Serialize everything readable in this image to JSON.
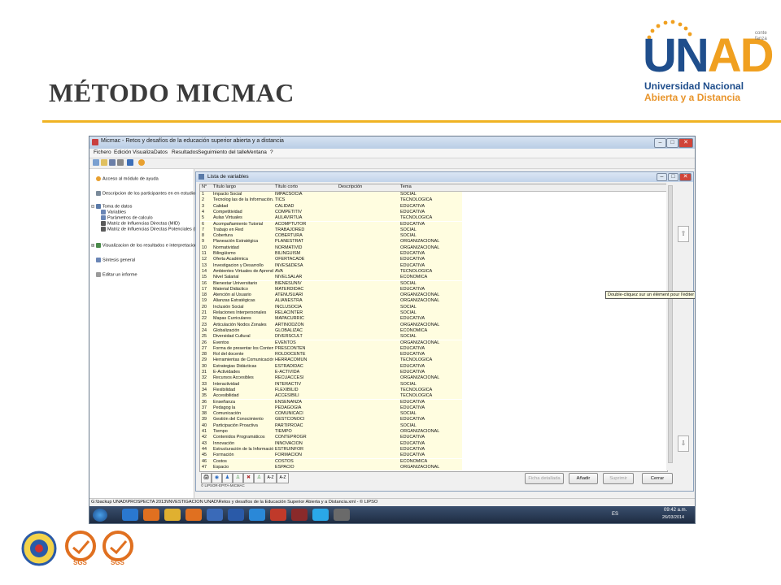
{
  "slide": {
    "title": "MÉTODO MICMAC"
  },
  "logo": {
    "letters_u": "U",
    "letters_n": "N",
    "letters_ad": "AD",
    "line1": "Universidad Nacional",
    "line2": "Abierta y a Distancia",
    "corner_text": "conte\nfanza"
  },
  "window": {
    "title": "Micmac  - Retos y desafíos de la educación superior abierta y a distancia",
    "menu": [
      "Fichero",
      "Edición",
      "Visualiza",
      "Datos",
      "Resultados",
      "Seguimiento del taller",
      "Ventana",
      "?"
    ]
  },
  "tree": {
    "items": [
      {
        "label": "Acceso al módulo de ayuda",
        "icon": "help-icon"
      },
      {
        "label": "Descripcion de los participantes en en estudio",
        "icon": "people-icon"
      },
      {
        "label": "Toma de datos",
        "icon": "data-icon"
      },
      {
        "label": "Variables",
        "icon": "variables-icon"
      },
      {
        "label": "Parámetros de calculo",
        "icon": "params-icon"
      },
      {
        "label": "Matriz de Influencias Directas (MID)",
        "icon": "matrix-icon"
      },
      {
        "label": "Matriz de Influencias Directas Potenciales (M",
        "icon": "matrix-icon"
      },
      {
        "label": "Visualizacion de los resultados e interpretaciones",
        "icon": "chart-icon"
      },
      {
        "label": "Síntesis general",
        "icon": "summary-icon"
      },
      {
        "label": "Editar un informe",
        "icon": "edit-icon"
      }
    ]
  },
  "list": {
    "title": "Lista de variables",
    "columns": [
      "N°",
      "Título largo",
      "Título corto",
      "Descripción",
      "Tema"
    ],
    "rows": [
      [
        "1",
        "Impacto Social",
        "IMPACSOCIA",
        "",
        "SOCIAL"
      ],
      [
        "2",
        "Tecnolog las de la Información...",
        "TICS",
        "",
        "TECNOLÓGICA"
      ],
      [
        "3",
        "Calidad",
        "CALIDAD",
        "",
        "EDUCATIVA"
      ],
      [
        "4",
        "Competitividad",
        "COMPETITIV",
        "",
        "EDUCATIVA"
      ],
      [
        "5",
        "Aulas Virtuales",
        "AULAVIRTUA",
        "",
        "TECNOLÓGICA"
      ],
      [
        "6",
        "Acompañamiento Tutorial",
        "ACOMPTUTOR",
        "",
        "EDUCATIVA"
      ],
      [
        "7",
        "Trabajo en Red",
        "TRABAJORED",
        "",
        "SOCIAL"
      ],
      [
        "8",
        "Cobertura",
        "COBERTURA",
        "",
        "SOCIAL"
      ],
      [
        "9",
        "Planeación Estratégica",
        "PLANESTRAT",
        "",
        "ORGANIZACIONAL"
      ],
      [
        "10",
        "Normatividad",
        "NORMATIVID",
        "",
        "ORGANIZACIONAL"
      ],
      [
        "11",
        "Bilingüismo",
        "BILINGÜISM",
        "",
        "EDUCATIVA"
      ],
      [
        "12",
        "Oferta Académica",
        "OFERTACADE",
        "",
        "EDUCATIVA"
      ],
      [
        "13",
        "Investigacion y Desarrollo",
        "INVES&DESA",
        "",
        "EDUCATIVA"
      ],
      [
        "14",
        "Ambientes Virtuales de Aprend...",
        "AVA",
        "",
        "TECNOLÓGICA"
      ],
      [
        "15",
        "Nivel Salarial",
        "NIVELSALAR",
        "",
        "ECONÓMICA"
      ],
      [
        "16",
        "Bienestar Universitario",
        "BIENESUNIV",
        "",
        "SOCIAL"
      ],
      [
        "17",
        "Material Didáctico",
        "MATERDIDAC",
        "",
        "EDUCATIVA"
      ],
      [
        "18",
        "Atención al Usuario",
        "ATENUSUARI",
        "",
        "ORGANIZACIONAL"
      ],
      [
        "19",
        "Alianzas Estratégicas",
        "ALIANESTRA",
        "",
        "ORGANIZACIONAL"
      ],
      [
        "20",
        "Inclusión Social",
        "INCLUSOCIA",
        "",
        "SOCIAL"
      ],
      [
        "21",
        "Relaciones Interpersonales",
        "RELACINTER",
        "",
        "SOCIAL"
      ],
      [
        "22",
        "Mapas Curriculares",
        "MAPACURRIC",
        "",
        "EDUCATIVA"
      ],
      [
        "23",
        "Articulación Nodos Zonales",
        "ARTINODZON",
        "",
        "ORGANIZACIONAL"
      ],
      [
        "24",
        "Globalización",
        "GLOBALIZAC",
        "",
        "ECONÓMICA"
      ],
      [
        "25",
        "Diversidad Cultural",
        "DIVERSCULT",
        "",
        "SOCIAL"
      ],
      [
        "26",
        "Eventos",
        "EVENTOS",
        "",
        "ORGANIZACIONAL"
      ],
      [
        "27",
        "Forma de presentar los Conten...",
        "PRESCONTEN",
        "",
        "EDUCATIVA"
      ],
      [
        "28",
        "Rol del docente",
        "ROLDOCENTE",
        "",
        "EDUCATIVA"
      ],
      [
        "29",
        "Herramientas de Comunicación",
        "HERRACOMUN",
        "",
        "TECNOLÓGICA"
      ],
      [
        "30",
        "Estrategias Didácticas",
        "ESTRADIDAC",
        "",
        "EDUCATIVA"
      ],
      [
        "31",
        "E-Actividades",
        "E-ACTIVIDA",
        "",
        "EDUCATIVA"
      ],
      [
        "32",
        "Recursos Accesibles",
        "RECUACCESI",
        "",
        "ORGANIZACIONAL"
      ],
      [
        "33",
        "Interactividad",
        "INTERACTIV",
        "",
        "SOCIAL"
      ],
      [
        "34",
        "Flexibilidad",
        "FLEXIBILID",
        "",
        "TECNOLÓGICA"
      ],
      [
        "35",
        "Accesibilidad",
        "ACCESIBILI",
        "",
        "TECNOLÓGICA"
      ],
      [
        "36",
        "Enseñanza",
        "ENSEÑANZA",
        "",
        "EDUCATIVA"
      ],
      [
        "37",
        "Pedagog la",
        "PEDAGOGIA",
        "",
        "EDUCATIVA"
      ],
      [
        "38",
        "Comunicación",
        "COMUNICACI",
        "",
        "SOCIAL"
      ],
      [
        "39",
        "Gestión del Conocimiento",
        "GESTCONOCI",
        "",
        "EDUCATIVA"
      ],
      [
        "40",
        "Participación Proactiva",
        "PARTIPROAC",
        "",
        "SOCIAL"
      ],
      [
        "41",
        "Tiempo",
        "TIEMPO",
        "",
        "ORGANIZACIONAL"
      ],
      [
        "42",
        "Contenidos Programáticos",
        "CONTEPROGR",
        "",
        "EDUCATIVA"
      ],
      [
        "43",
        "Innovación",
        "INNOVACION",
        "",
        "EDUCATIVA"
      ],
      [
        "44",
        "Estructuración de la Información",
        "ESTRUINFOR",
        "",
        "EDUCATIVA"
      ],
      [
        "45",
        "Formación",
        "FORMACION",
        "",
        "EDUCATIVA"
      ],
      [
        "46",
        "Costos",
        "COSTOS",
        "",
        "ECONÓMICA"
      ],
      [
        "47",
        "Espacio",
        "ESPACIO",
        "",
        "ORGANIZACIONAL"
      ]
    ],
    "tooltip": "Double-cliquez sur un élément pour l'éditer",
    "copyright": "© LIPSOR-EPITA-MICMAC",
    "buttons": {
      "detail": "Ficha detallada",
      "add": "Añadir",
      "delete": "Suprimir",
      "close": "Cerrar"
    },
    "sort_az": "A-Z",
    "sort_za": "A-Z"
  },
  "status": {
    "path": "G:\\backup UNAD\\PROSPECTA 2013\\INVESTIGACION UNAD\\Retos y desafíos de la Educación Superior Abierta y a Distancia.xml  - © LIPSO"
  },
  "taskbar": {
    "lang": "ES",
    "time": "09:42 a.m.",
    "date": "26/03/2014"
  },
  "footer": {
    "sgs1": "SGS",
    "sgs2": "SGS"
  }
}
